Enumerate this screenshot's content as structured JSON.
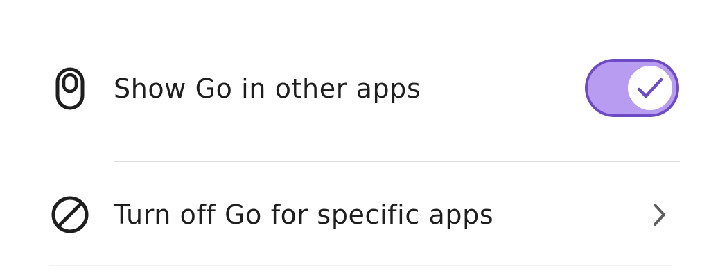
{
  "settings": {
    "show_go": {
      "label": "Show Go in other apps",
      "toggle_on": true,
      "icon": "go-pill-icon"
    },
    "turn_off": {
      "label": "Turn off Go for specific apps",
      "icon": "block-icon",
      "trailing_icon": "chevron-right-icon"
    }
  },
  "colors": {
    "toggle_track": "#b79cf1",
    "toggle_border": "#6e4bc5",
    "check": "#6e4bc5",
    "text": "#1e1e1e",
    "divider": "#dcdcdc"
  }
}
